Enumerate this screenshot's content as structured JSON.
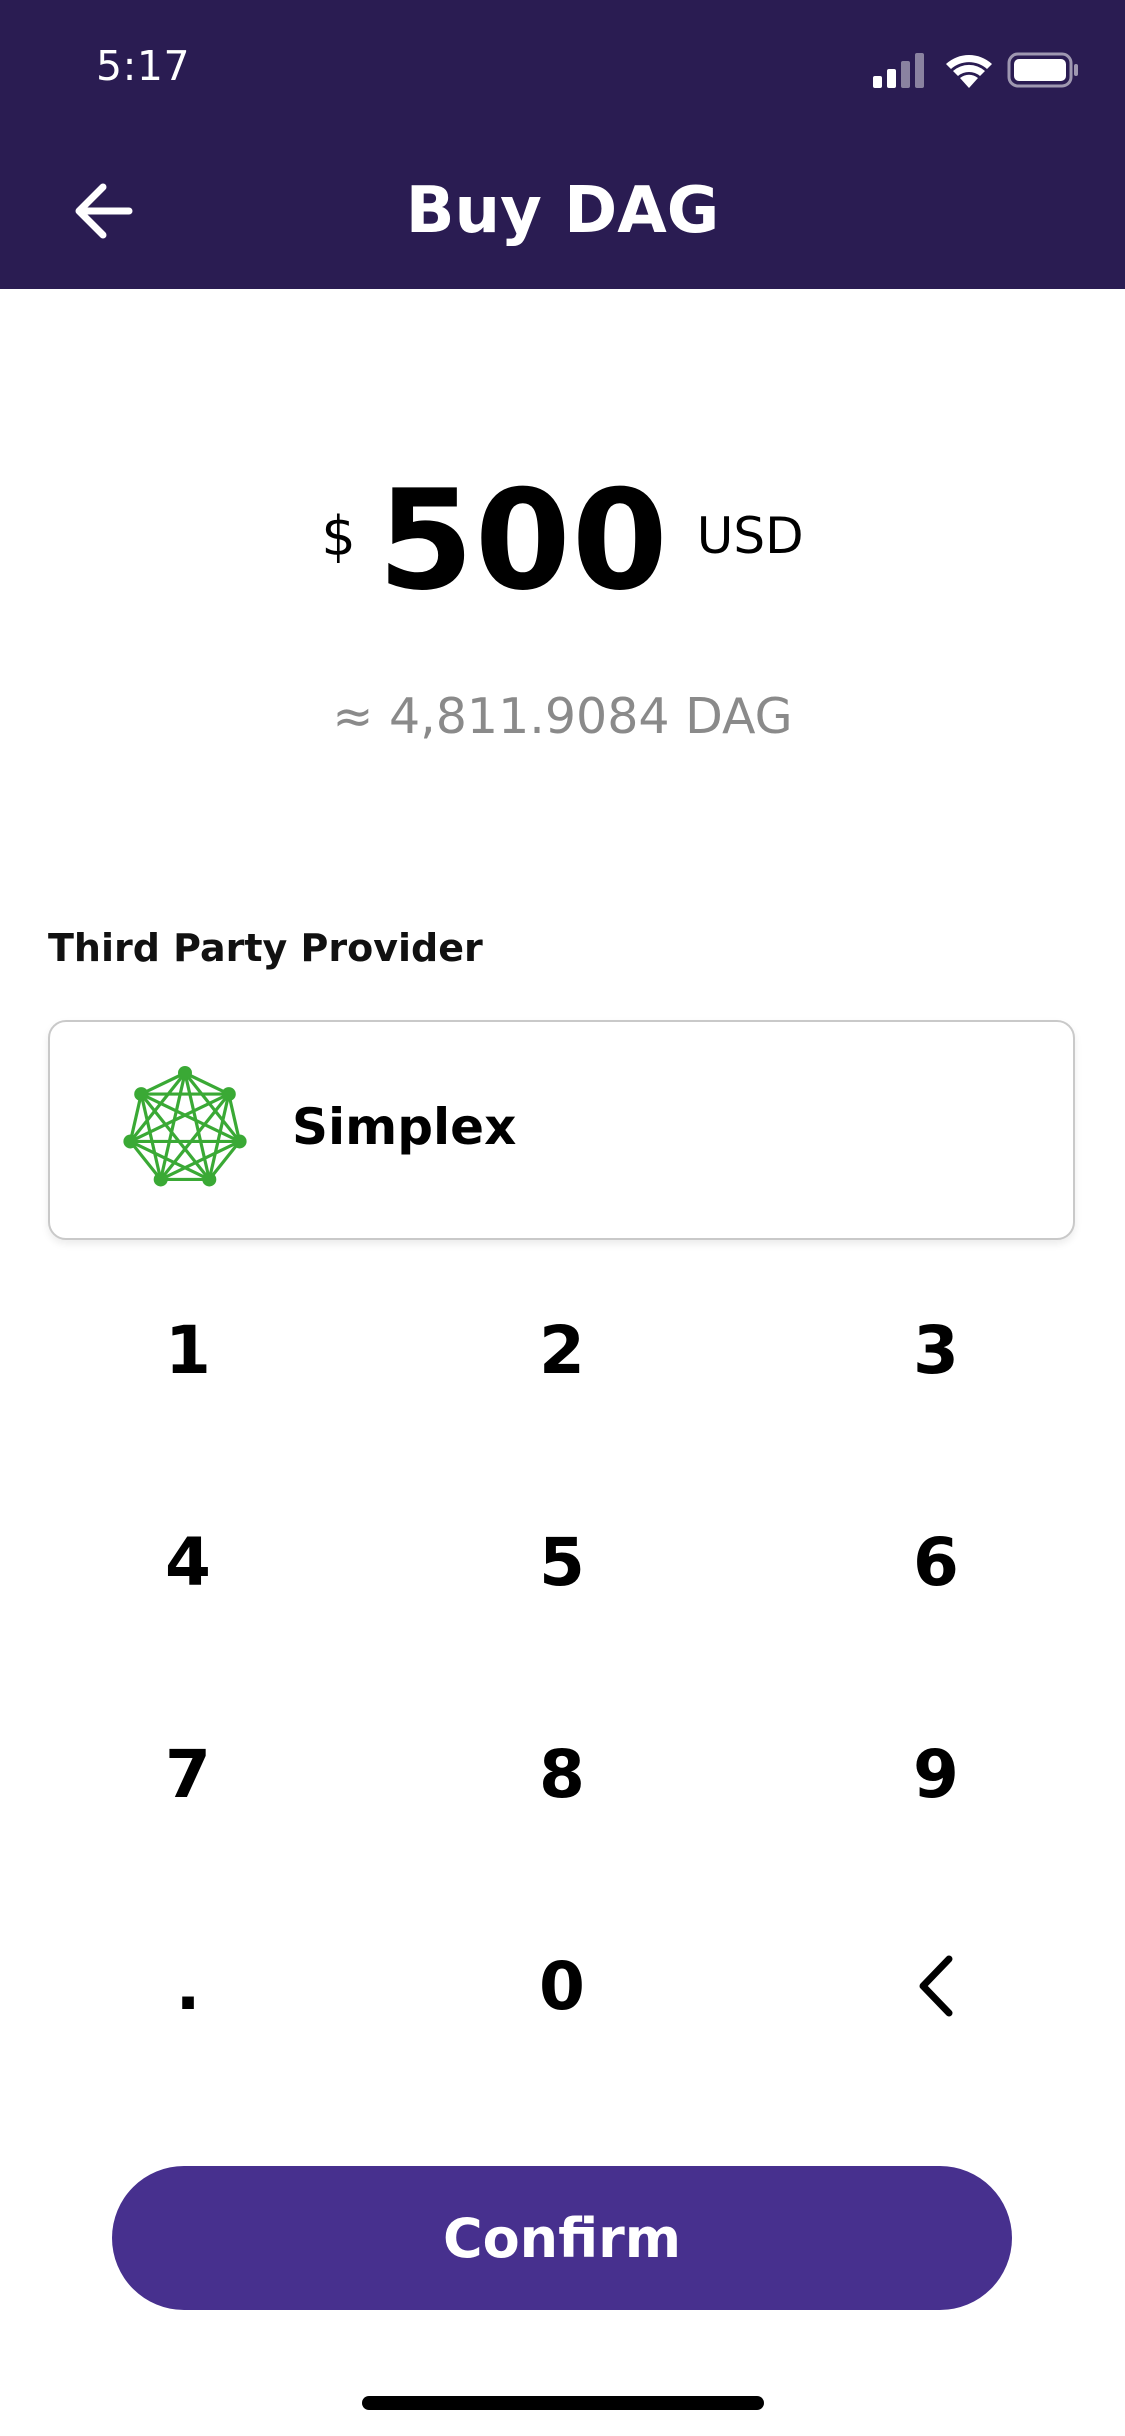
{
  "status_bar": {
    "time": "5:17",
    "icons": [
      "signal-icon",
      "wifi-icon",
      "battery-icon"
    ]
  },
  "header": {
    "title": "Buy DAG",
    "back_icon": "arrow-left-icon",
    "background": "#2a1c52"
  },
  "amount": {
    "currency_symbol": "$",
    "value": "500",
    "unit": "USD",
    "conversion": "≈ 4,811.9084 DAG"
  },
  "provider": {
    "section_label": "Third Party Provider",
    "name": "Simplex",
    "logo_icon": "simplex-network-logo-icon",
    "logo_color": "#3aa935"
  },
  "keypad": {
    "keys": [
      "1",
      "2",
      "3",
      "4",
      "5",
      "6",
      "7",
      "8",
      "9",
      ".",
      "0"
    ],
    "backspace_icon": "chevron-left-icon"
  },
  "confirm_button": {
    "label": "Confirm",
    "color": "#47308e"
  }
}
